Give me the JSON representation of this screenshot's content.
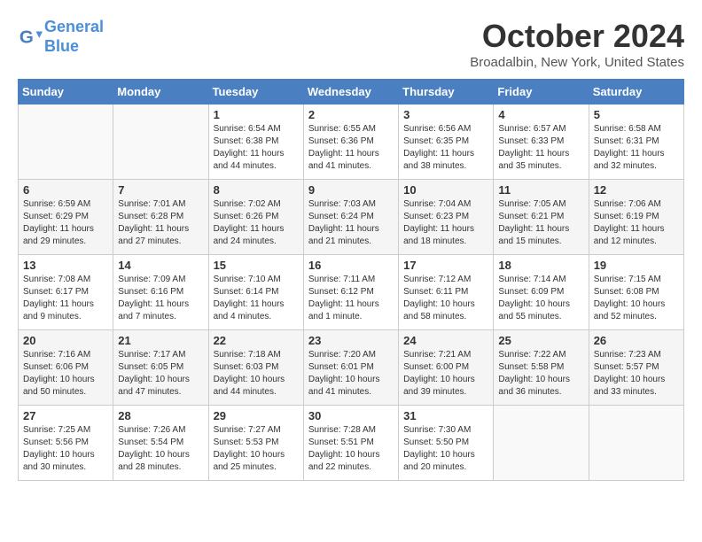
{
  "logo": {
    "line1": "General",
    "line2": "Blue"
  },
  "title": "October 2024",
  "location": "Broadalbin, New York, United States",
  "headers": [
    "Sunday",
    "Monday",
    "Tuesday",
    "Wednesday",
    "Thursday",
    "Friday",
    "Saturday"
  ],
  "weeks": [
    [
      {
        "day": "",
        "info": ""
      },
      {
        "day": "",
        "info": ""
      },
      {
        "day": "1",
        "info": "Sunrise: 6:54 AM\nSunset: 6:38 PM\nDaylight: 11 hours and 44 minutes."
      },
      {
        "day": "2",
        "info": "Sunrise: 6:55 AM\nSunset: 6:36 PM\nDaylight: 11 hours and 41 minutes."
      },
      {
        "day": "3",
        "info": "Sunrise: 6:56 AM\nSunset: 6:35 PM\nDaylight: 11 hours and 38 minutes."
      },
      {
        "day": "4",
        "info": "Sunrise: 6:57 AM\nSunset: 6:33 PM\nDaylight: 11 hours and 35 minutes."
      },
      {
        "day": "5",
        "info": "Sunrise: 6:58 AM\nSunset: 6:31 PM\nDaylight: 11 hours and 32 minutes."
      }
    ],
    [
      {
        "day": "6",
        "info": "Sunrise: 6:59 AM\nSunset: 6:29 PM\nDaylight: 11 hours and 29 minutes."
      },
      {
        "day": "7",
        "info": "Sunrise: 7:01 AM\nSunset: 6:28 PM\nDaylight: 11 hours and 27 minutes."
      },
      {
        "day": "8",
        "info": "Sunrise: 7:02 AM\nSunset: 6:26 PM\nDaylight: 11 hours and 24 minutes."
      },
      {
        "day": "9",
        "info": "Sunrise: 7:03 AM\nSunset: 6:24 PM\nDaylight: 11 hours and 21 minutes."
      },
      {
        "day": "10",
        "info": "Sunrise: 7:04 AM\nSunset: 6:23 PM\nDaylight: 11 hours and 18 minutes."
      },
      {
        "day": "11",
        "info": "Sunrise: 7:05 AM\nSunset: 6:21 PM\nDaylight: 11 hours and 15 minutes."
      },
      {
        "day": "12",
        "info": "Sunrise: 7:06 AM\nSunset: 6:19 PM\nDaylight: 11 hours and 12 minutes."
      }
    ],
    [
      {
        "day": "13",
        "info": "Sunrise: 7:08 AM\nSunset: 6:17 PM\nDaylight: 11 hours and 9 minutes."
      },
      {
        "day": "14",
        "info": "Sunrise: 7:09 AM\nSunset: 6:16 PM\nDaylight: 11 hours and 7 minutes."
      },
      {
        "day": "15",
        "info": "Sunrise: 7:10 AM\nSunset: 6:14 PM\nDaylight: 11 hours and 4 minutes."
      },
      {
        "day": "16",
        "info": "Sunrise: 7:11 AM\nSunset: 6:12 PM\nDaylight: 11 hours and 1 minute."
      },
      {
        "day": "17",
        "info": "Sunrise: 7:12 AM\nSunset: 6:11 PM\nDaylight: 10 hours and 58 minutes."
      },
      {
        "day": "18",
        "info": "Sunrise: 7:14 AM\nSunset: 6:09 PM\nDaylight: 10 hours and 55 minutes."
      },
      {
        "day": "19",
        "info": "Sunrise: 7:15 AM\nSunset: 6:08 PM\nDaylight: 10 hours and 52 minutes."
      }
    ],
    [
      {
        "day": "20",
        "info": "Sunrise: 7:16 AM\nSunset: 6:06 PM\nDaylight: 10 hours and 50 minutes."
      },
      {
        "day": "21",
        "info": "Sunrise: 7:17 AM\nSunset: 6:05 PM\nDaylight: 10 hours and 47 minutes."
      },
      {
        "day": "22",
        "info": "Sunrise: 7:18 AM\nSunset: 6:03 PM\nDaylight: 10 hours and 44 minutes."
      },
      {
        "day": "23",
        "info": "Sunrise: 7:20 AM\nSunset: 6:01 PM\nDaylight: 10 hours and 41 minutes."
      },
      {
        "day": "24",
        "info": "Sunrise: 7:21 AM\nSunset: 6:00 PM\nDaylight: 10 hours and 39 minutes."
      },
      {
        "day": "25",
        "info": "Sunrise: 7:22 AM\nSunset: 5:58 PM\nDaylight: 10 hours and 36 minutes."
      },
      {
        "day": "26",
        "info": "Sunrise: 7:23 AM\nSunset: 5:57 PM\nDaylight: 10 hours and 33 minutes."
      }
    ],
    [
      {
        "day": "27",
        "info": "Sunrise: 7:25 AM\nSunset: 5:56 PM\nDaylight: 10 hours and 30 minutes."
      },
      {
        "day": "28",
        "info": "Sunrise: 7:26 AM\nSunset: 5:54 PM\nDaylight: 10 hours and 28 minutes."
      },
      {
        "day": "29",
        "info": "Sunrise: 7:27 AM\nSunset: 5:53 PM\nDaylight: 10 hours and 25 minutes."
      },
      {
        "day": "30",
        "info": "Sunrise: 7:28 AM\nSunset: 5:51 PM\nDaylight: 10 hours and 22 minutes."
      },
      {
        "day": "31",
        "info": "Sunrise: 7:30 AM\nSunset: 5:50 PM\nDaylight: 10 hours and 20 minutes."
      },
      {
        "day": "",
        "info": ""
      },
      {
        "day": "",
        "info": ""
      }
    ]
  ]
}
